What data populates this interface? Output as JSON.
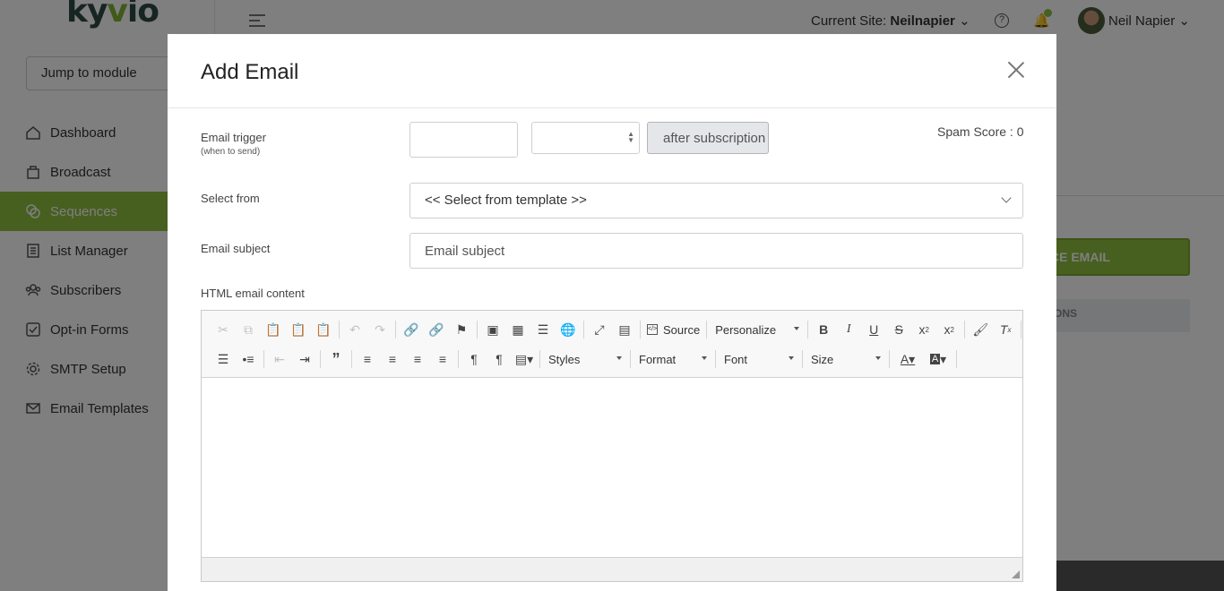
{
  "app": {
    "logo_text": "kyvio",
    "jump_label": "Jump to module",
    "current_site_label": "Current Site:",
    "current_site_value": "Neilnapier",
    "user_name": "Neil Napier",
    "accent_color": "#8fbf3f"
  },
  "sidebar": {
    "items": [
      {
        "label": "Dashboard",
        "icon": "home-icon"
      },
      {
        "label": "Broadcast",
        "icon": "bag-icon"
      },
      {
        "label": "Sequences",
        "icon": "sequence-icon",
        "active": true
      },
      {
        "label": "List Manager",
        "icon": "list-icon"
      },
      {
        "label": "Subscribers",
        "icon": "users-icon"
      },
      {
        "label": "Opt-in Forms",
        "icon": "checkbox-icon"
      },
      {
        "label": "SMTP Setup",
        "icon": "gear-icon"
      },
      {
        "label": "Email Templates",
        "icon": "mail-icon"
      }
    ]
  },
  "background": {
    "sequence_button_label": "CE EMAIL",
    "tab_label": "ONS"
  },
  "modal": {
    "title": "Add Email",
    "trigger_label": "Email trigger",
    "trigger_sublabel": "(when to send)",
    "trigger_after": "after subscription",
    "spam_score": "Spam Score : 0",
    "select_from_label": "Select from",
    "select_from_value": "<< Select from template >>",
    "subject_label": "Email subject",
    "subject_placeholder": "Email subject",
    "html_content_label": "HTML email content"
  },
  "editor": {
    "source_label": "Source",
    "personalize_label": "Personalize",
    "styles_label": "Styles",
    "format_label": "Format",
    "font_label": "Font",
    "size_label": "Size"
  }
}
